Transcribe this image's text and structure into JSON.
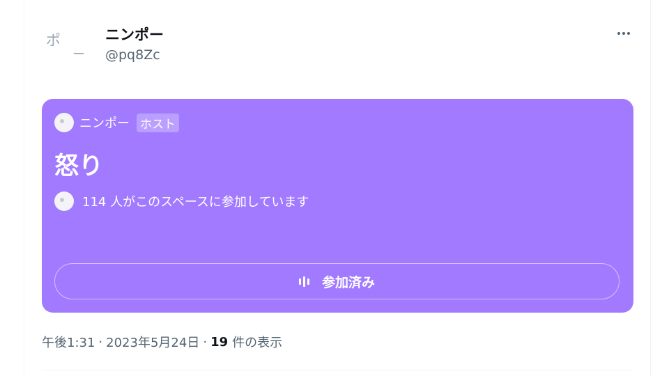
{
  "tweet": {
    "author": {
      "display_name": "ニンポー",
      "handle": "@pq8Zc",
      "avatar_text_main": "ポ",
      "avatar_text_dash": "ー"
    },
    "more_icon": "more-horizontal-icon"
  },
  "space": {
    "background_color": "#a17aff",
    "host_name": "ニンポー",
    "host_badge": "ホスト",
    "title": "怒り",
    "listeners_text": "114 人がこのスペースに参加しています",
    "joined_button_label": "参加済み",
    "joined_button_icon": "audio-bars-icon"
  },
  "meta": {
    "time": "午後1:31",
    "separator": "·",
    "date": "2023年5月24日",
    "views_count": "19",
    "views_label": "件の表示"
  }
}
